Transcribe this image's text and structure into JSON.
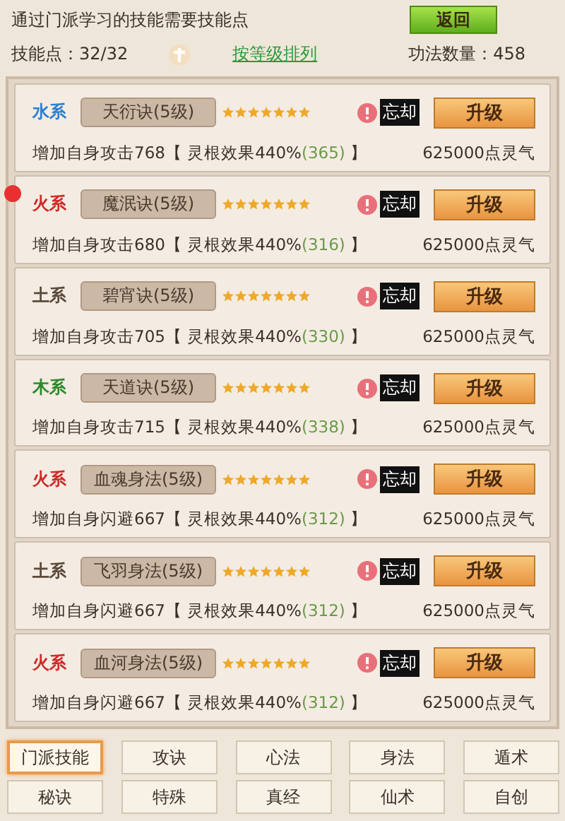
{
  "header": {
    "notice": "通过门派学习的技能需要技能点",
    "back_button": "返回",
    "skill_points": "技能点：32/32",
    "sort_link": "按等级排列",
    "count": "功法数量：458"
  },
  "skills": [
    {
      "element": "水系",
      "color": "#2f7fd0",
      "name": "天衍诀(5级)",
      "stars": 7,
      "alert": false,
      "forget": "忘却",
      "upgrade": "升级",
      "effect": "增加自身攻击768【 灵根效果440%",
      "bonus": "(365)",
      "effect_end": " 】",
      "cost": "625000点灵气"
    },
    {
      "element": "火系",
      "color": "#d02a2a",
      "name": "魔泯诀(5级)",
      "stars": 7,
      "alert": true,
      "forget": "忘却",
      "upgrade": "升级",
      "effect": "增加自身攻击680【 灵根效果440%",
      "bonus": "(316)",
      "effect_end": " 】",
      "cost": "625000点灵气"
    },
    {
      "element": "土系",
      "color": "#5a4a3a",
      "name": "碧宵诀(5级)",
      "stars": 7,
      "alert": false,
      "forget": "忘却",
      "upgrade": "升级",
      "effect": "增加自身攻击705【 灵根效果440%",
      "bonus": "(330)",
      "effect_end": " 】",
      "cost": "625000点灵气"
    },
    {
      "element": "木系",
      "color": "#2e8a2e",
      "name": "天道诀(5级)",
      "stars": 7,
      "alert": false,
      "forget": "忘却",
      "upgrade": "升级",
      "effect": "增加自身攻击715【 灵根效果440%",
      "bonus": "(338)",
      "effect_end": " 】",
      "cost": "625000点灵气"
    },
    {
      "element": "火系",
      "color": "#d02a2a",
      "name": "血魂身法(5级)",
      "stars": 7,
      "alert": false,
      "forget": "忘却",
      "upgrade": "升级",
      "effect": "增加自身闪避667【 灵根效果440%",
      "bonus": "(312)",
      "effect_end": " 】",
      "cost": "625000点灵气"
    },
    {
      "element": "土系",
      "color": "#5a4a3a",
      "name": "飞羽身法(5级)",
      "stars": 7,
      "alert": false,
      "forget": "忘却",
      "upgrade": "升级",
      "effect": "增加自身闪避667【 灵根效果440%",
      "bonus": "(312)",
      "effect_end": " 】",
      "cost": "625000点灵气"
    },
    {
      "element": "火系",
      "color": "#d02a2a",
      "name": "血河身法(5级)",
      "stars": 7,
      "alert": false,
      "forget": "忘却",
      "upgrade": "升级",
      "effect": "增加自身闪避667【 灵根效果440%",
      "bonus": "(312)",
      "effect_end": " 】",
      "cost": "625000点灵气"
    }
  ],
  "tabs": [
    {
      "label": "门派技能",
      "selected": true
    },
    {
      "label": "攻诀",
      "selected": false
    },
    {
      "label": "心法",
      "selected": false
    },
    {
      "label": "身法",
      "selected": false
    },
    {
      "label": "遁术",
      "selected": false
    },
    {
      "label": "秘诀",
      "selected": false
    },
    {
      "label": "特殊",
      "selected": false
    },
    {
      "label": "真经",
      "selected": false
    },
    {
      "label": "仙术",
      "selected": false
    },
    {
      "label": "自创",
      "selected": false
    }
  ]
}
